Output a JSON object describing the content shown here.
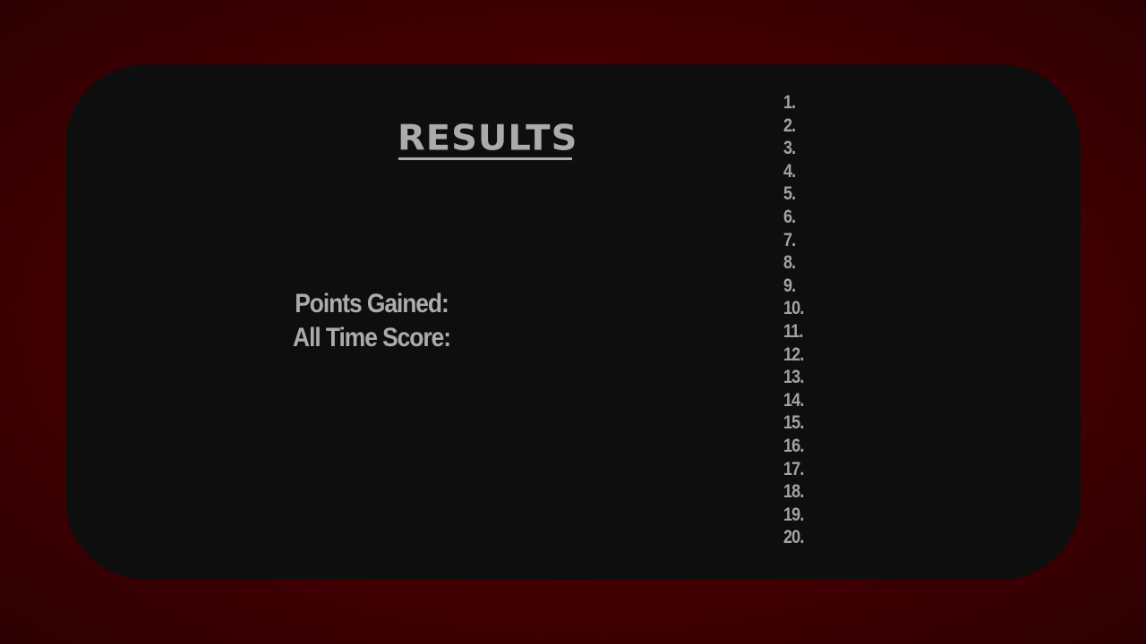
{
  "results": {
    "title": "RESULTS",
    "points_gained_label": "Points Gained:",
    "all_time_score_label": "All Time Score:"
  },
  "leaderboard": {
    "ranks": [
      "1.",
      "2.",
      "3.",
      "4.",
      "5.",
      "6.",
      "7.",
      "8.",
      "9.",
      "10.",
      "11.",
      "12.",
      "13.",
      "14.",
      "15.",
      "16.",
      "17.",
      "18.",
      "19.",
      "20."
    ]
  },
  "colors": {
    "background": "#4a0003",
    "panel": "#0e0e0e",
    "text": "#ababab"
  }
}
